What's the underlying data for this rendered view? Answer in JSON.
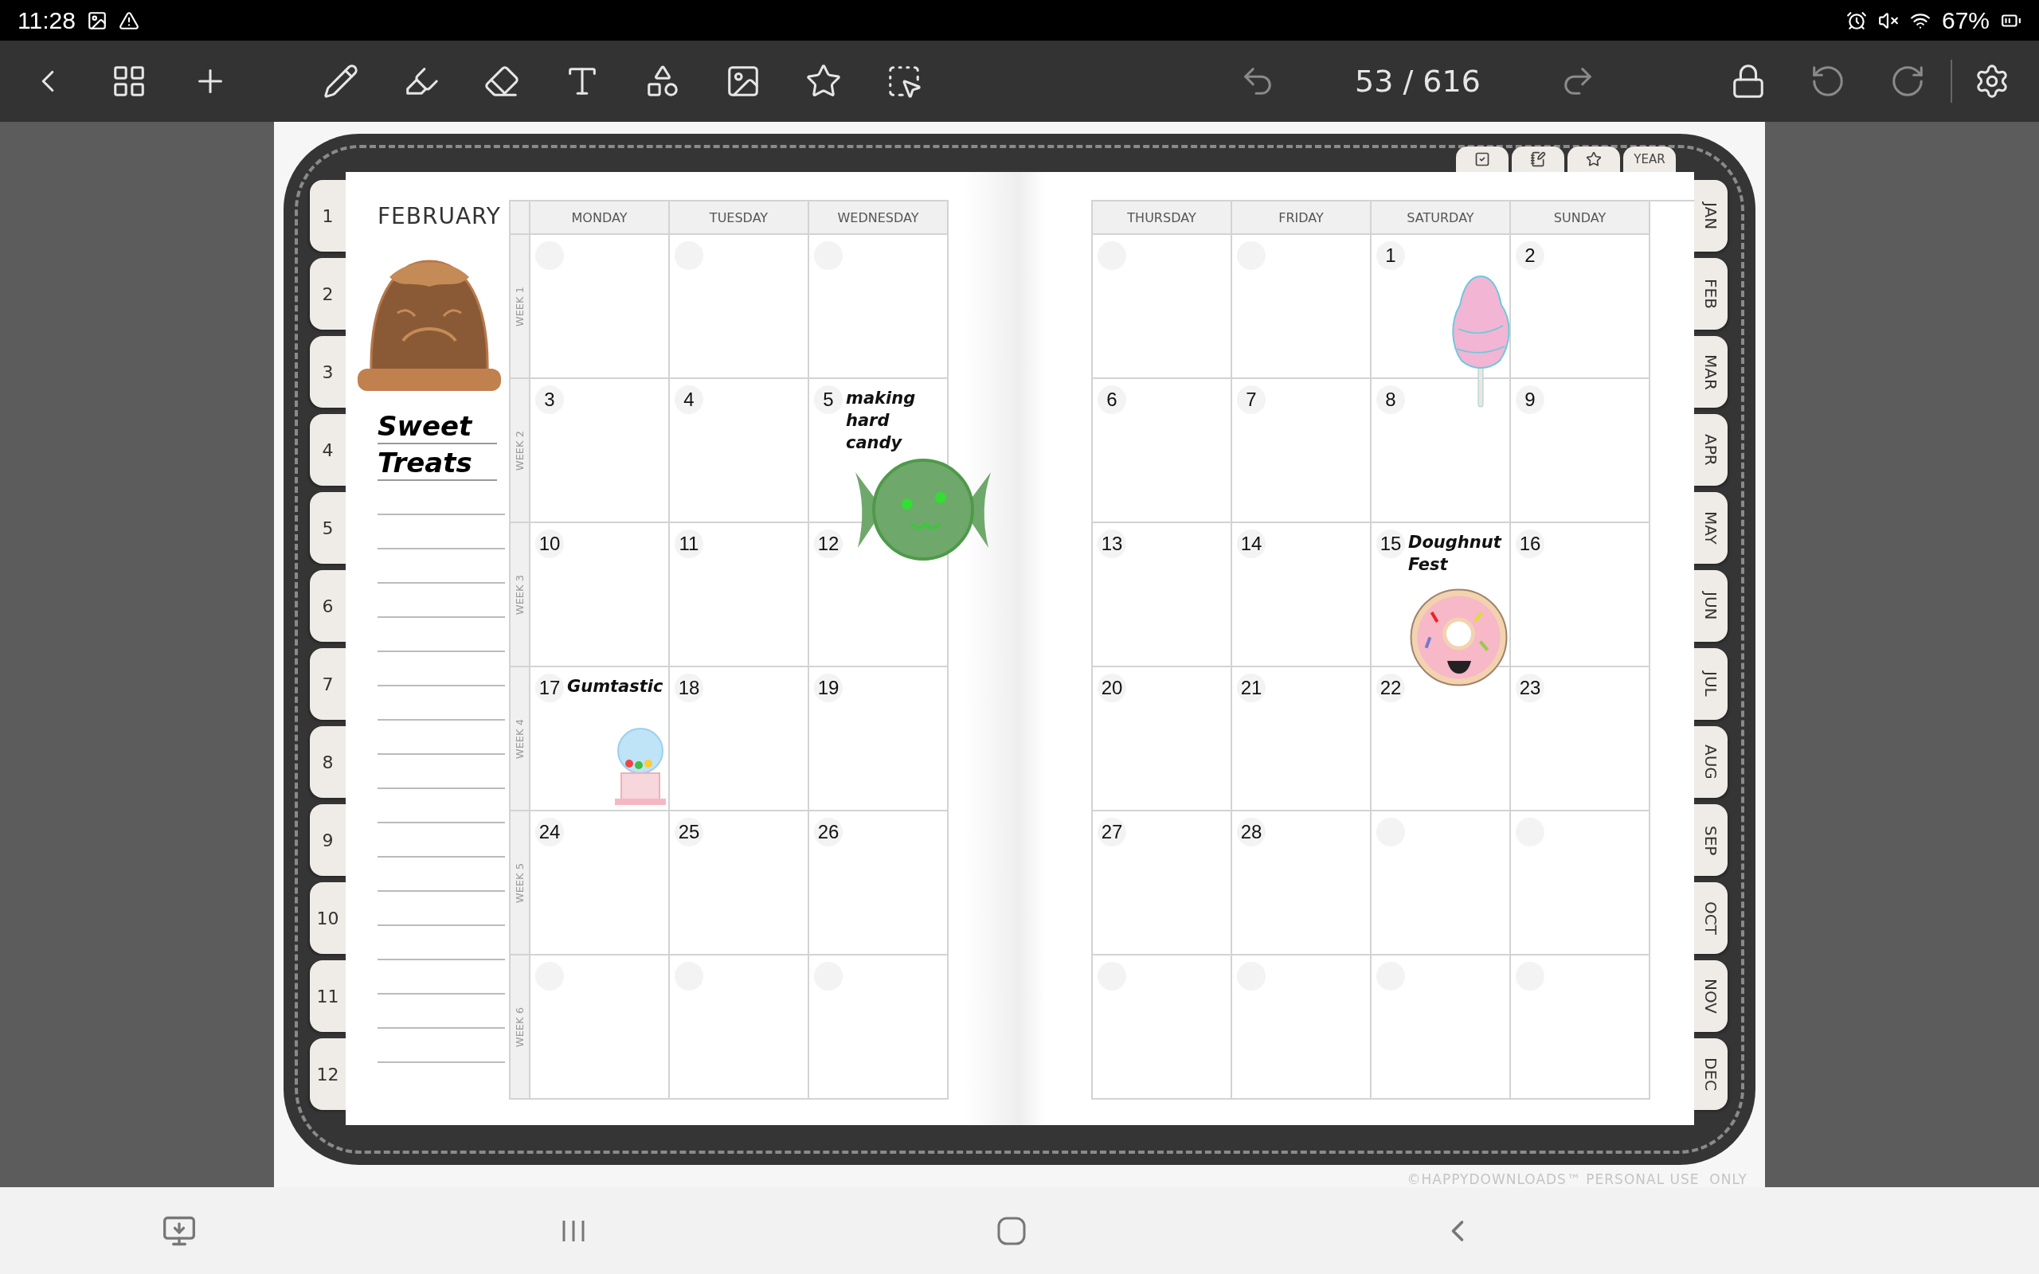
{
  "status_bar": {
    "time": "11:28",
    "battery": "67%"
  },
  "toolbar": {
    "page_indicator": "53 / 616"
  },
  "planner": {
    "month": "FEBRUARY",
    "notes_title": "Sweet Treats",
    "side_tabs": [
      "1",
      "2",
      "3",
      "4",
      "5",
      "6",
      "7",
      "8",
      "9",
      "10",
      "11",
      "12"
    ],
    "top_tabs": [
      {
        "kind": "checklist"
      },
      {
        "kind": "notes"
      },
      {
        "kind": "favorites"
      },
      {
        "kind": "label",
        "label": "YEAR"
      }
    ],
    "month_tabs": [
      "JAN",
      "FEB",
      "MAR",
      "APR",
      "MAY",
      "JUN",
      "JUL",
      "AUG",
      "SEP",
      "OCT",
      "NOV",
      "DEC"
    ],
    "left_page": {
      "columns": [
        "MONDAY",
        "TUESDAY",
        "WEDNESDAY"
      ],
      "weeks": [
        "WEEK 1",
        "WEEK 2",
        "WEEK 3",
        "WEEK 4",
        "WEEK 5",
        "WEEK 6"
      ],
      "rows": [
        [
          {},
          {},
          {}
        ],
        [
          {
            "day": "3"
          },
          {
            "day": "4"
          },
          {
            "day": "5",
            "note": "making hard candy"
          }
        ],
        [
          {
            "day": "10"
          },
          {
            "day": "11"
          },
          {
            "day": "12"
          }
        ],
        [
          {
            "day": "17",
            "note": "Gumtastic"
          },
          {
            "day": "18"
          },
          {
            "day": "19"
          }
        ],
        [
          {
            "day": "24"
          },
          {
            "day": "25"
          },
          {
            "day": "26"
          }
        ],
        [
          {},
          {},
          {}
        ]
      ]
    },
    "right_page": {
      "columns": [
        "THURSDAY",
        "FRIDAY",
        "SATURDAY",
        "SUNDAY"
      ],
      "rows": [
        [
          {},
          {},
          {
            "day": "1"
          },
          {
            "day": "2"
          }
        ],
        [
          {
            "day": "6"
          },
          {
            "day": "7"
          },
          {
            "day": "8"
          },
          {
            "day": "9"
          }
        ],
        [
          {
            "day": "13"
          },
          {
            "day": "14"
          },
          {
            "day": "15",
            "note": "Doughnut Fest"
          },
          {
            "day": "16"
          }
        ],
        [
          {
            "day": "20"
          },
          {
            "day": "21"
          },
          {
            "day": "22"
          },
          {
            "day": "23"
          }
        ],
        [
          {
            "day": "27"
          },
          {
            "day": "28"
          },
          {},
          {}
        ],
        [
          {},
          {},
          {},
          {}
        ]
      ]
    },
    "footer": "©HAPPYDOWNLOADS™ PERSONAL USE  ONLY"
  }
}
